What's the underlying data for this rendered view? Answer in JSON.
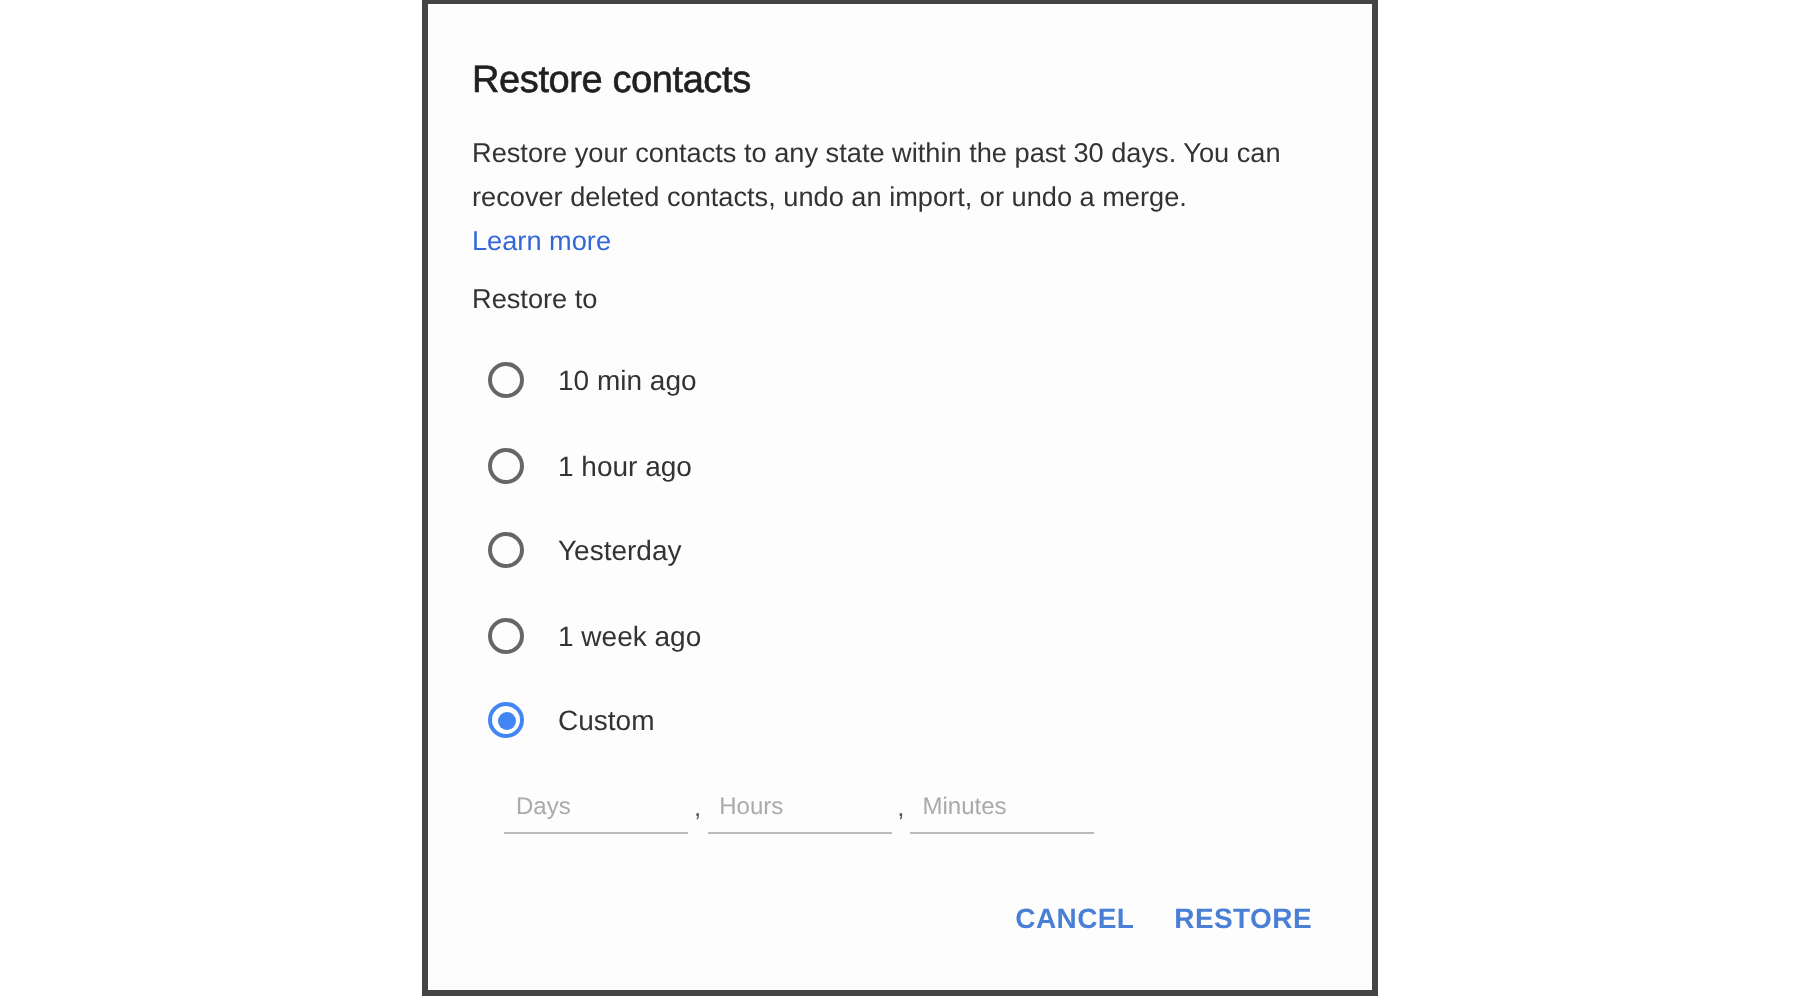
{
  "dialog": {
    "title": "Restore contacts",
    "description": "Restore your contacts to any state within the past 30 days. You can recover deleted contacts, undo an import, or undo a merge.",
    "link": "Learn more",
    "restore_to_label": "Restore to",
    "options": [
      {
        "label": "10 min ago",
        "selected": false
      },
      {
        "label": "1 hour ago",
        "selected": false
      },
      {
        "label": "Yesterday",
        "selected": false
      },
      {
        "label": "1 week ago",
        "selected": false
      },
      {
        "label": "Custom",
        "selected": true
      }
    ],
    "custom_fields": [
      {
        "placeholder": "Days"
      },
      {
        "separator": ",",
        "placeholder": "Hours"
      },
      {
        "separator": ",",
        "placeholder": "Minutes"
      }
    ],
    "buttons": [
      "CANCEL",
      "RESTORE"
    ]
  }
}
